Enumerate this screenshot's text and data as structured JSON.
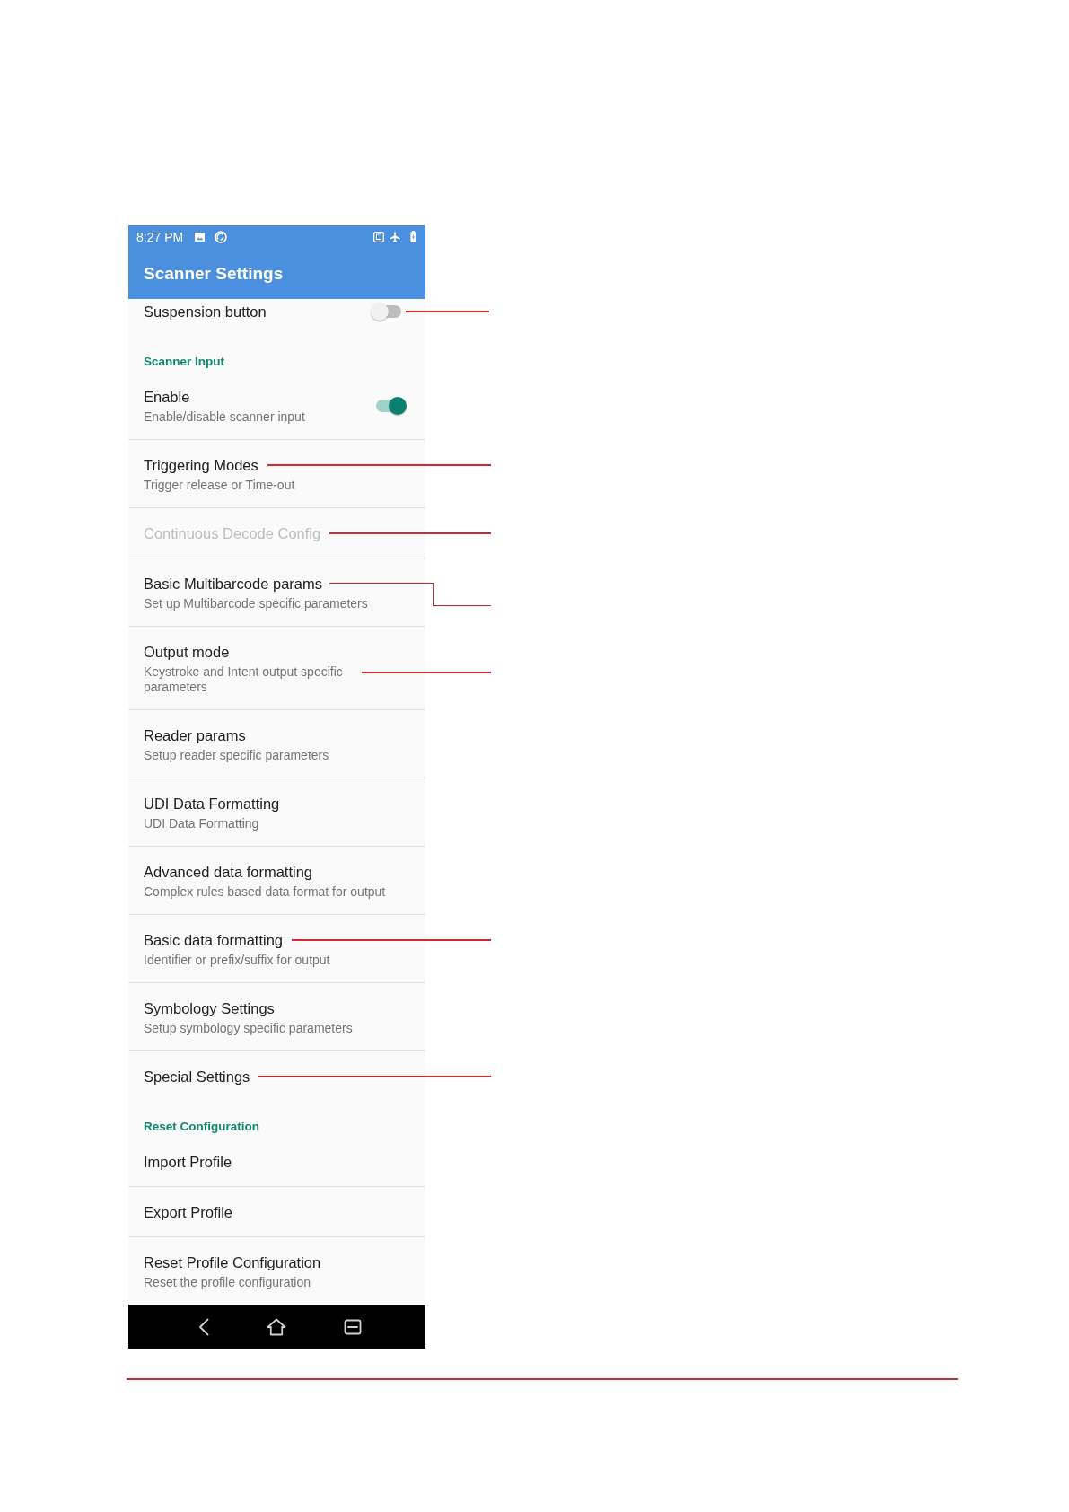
{
  "status_bar": {
    "time": "8:27 PM"
  },
  "toolbar": {
    "title": "Scanner Settings"
  },
  "sections": [
    {
      "items": [
        {
          "kind": "switch",
          "title": "Suspension button",
          "on": false,
          "disabled": false,
          "callout": {
            "kind": "straight"
          }
        }
      ]
    },
    {
      "title": "Scanner Input",
      "items": [
        {
          "kind": "switch",
          "title": "Enable",
          "summary": "Enable/disable scanner input",
          "on": true,
          "disabled": false
        },
        {
          "kind": "preference",
          "title": "Triggering Modes",
          "summary": "Trigger release or Time-out",
          "disabled": false,
          "callout": {
            "kind": "straight"
          }
        },
        {
          "kind": "preference",
          "title": "Continuous Decode Config",
          "disabled": true,
          "callout": {
            "kind": "straight"
          }
        },
        {
          "kind": "preference",
          "title": "Basic Multibarcode params",
          "summary": "Set up Multibarcode specific parameters",
          "disabled": false,
          "callout": {
            "kind": "elbow"
          }
        },
        {
          "kind": "preference",
          "title": "Output mode",
          "summary": "Keystroke and Intent output specific parameters",
          "disabled": false,
          "callout": {
            "kind": "summary"
          }
        },
        {
          "kind": "preference",
          "title": "Reader params",
          "summary": "Setup reader specific parameters",
          "disabled": false
        },
        {
          "kind": "preference",
          "title": "UDI Data Formatting",
          "summary": "UDI Data Formatting",
          "disabled": false
        },
        {
          "kind": "preference",
          "title": "Advanced data formatting",
          "summary": "Complex rules based data format for output",
          "disabled": false
        },
        {
          "kind": "preference",
          "title": "Basic data formatting",
          "summary": "Identifier or prefix/suffix for output",
          "disabled": false,
          "callout": {
            "kind": "straight"
          }
        },
        {
          "kind": "preference",
          "title": "Symbology Settings",
          "summary": "Setup symbology specific parameters",
          "disabled": false
        },
        {
          "kind": "preference",
          "title": "Special Settings",
          "disabled": false,
          "callout": {
            "kind": "straight"
          }
        }
      ]
    },
    {
      "title": "Reset Configuration",
      "items": [
        {
          "kind": "preference",
          "title": "Import Profile",
          "disabled": false
        },
        {
          "kind": "preference",
          "title": "Export Profile",
          "disabled": false
        },
        {
          "kind": "preference",
          "title": "Reset Profile Configuration",
          "summary": "Reset the profile configuration",
          "disabled": false
        }
      ]
    }
  ]
}
